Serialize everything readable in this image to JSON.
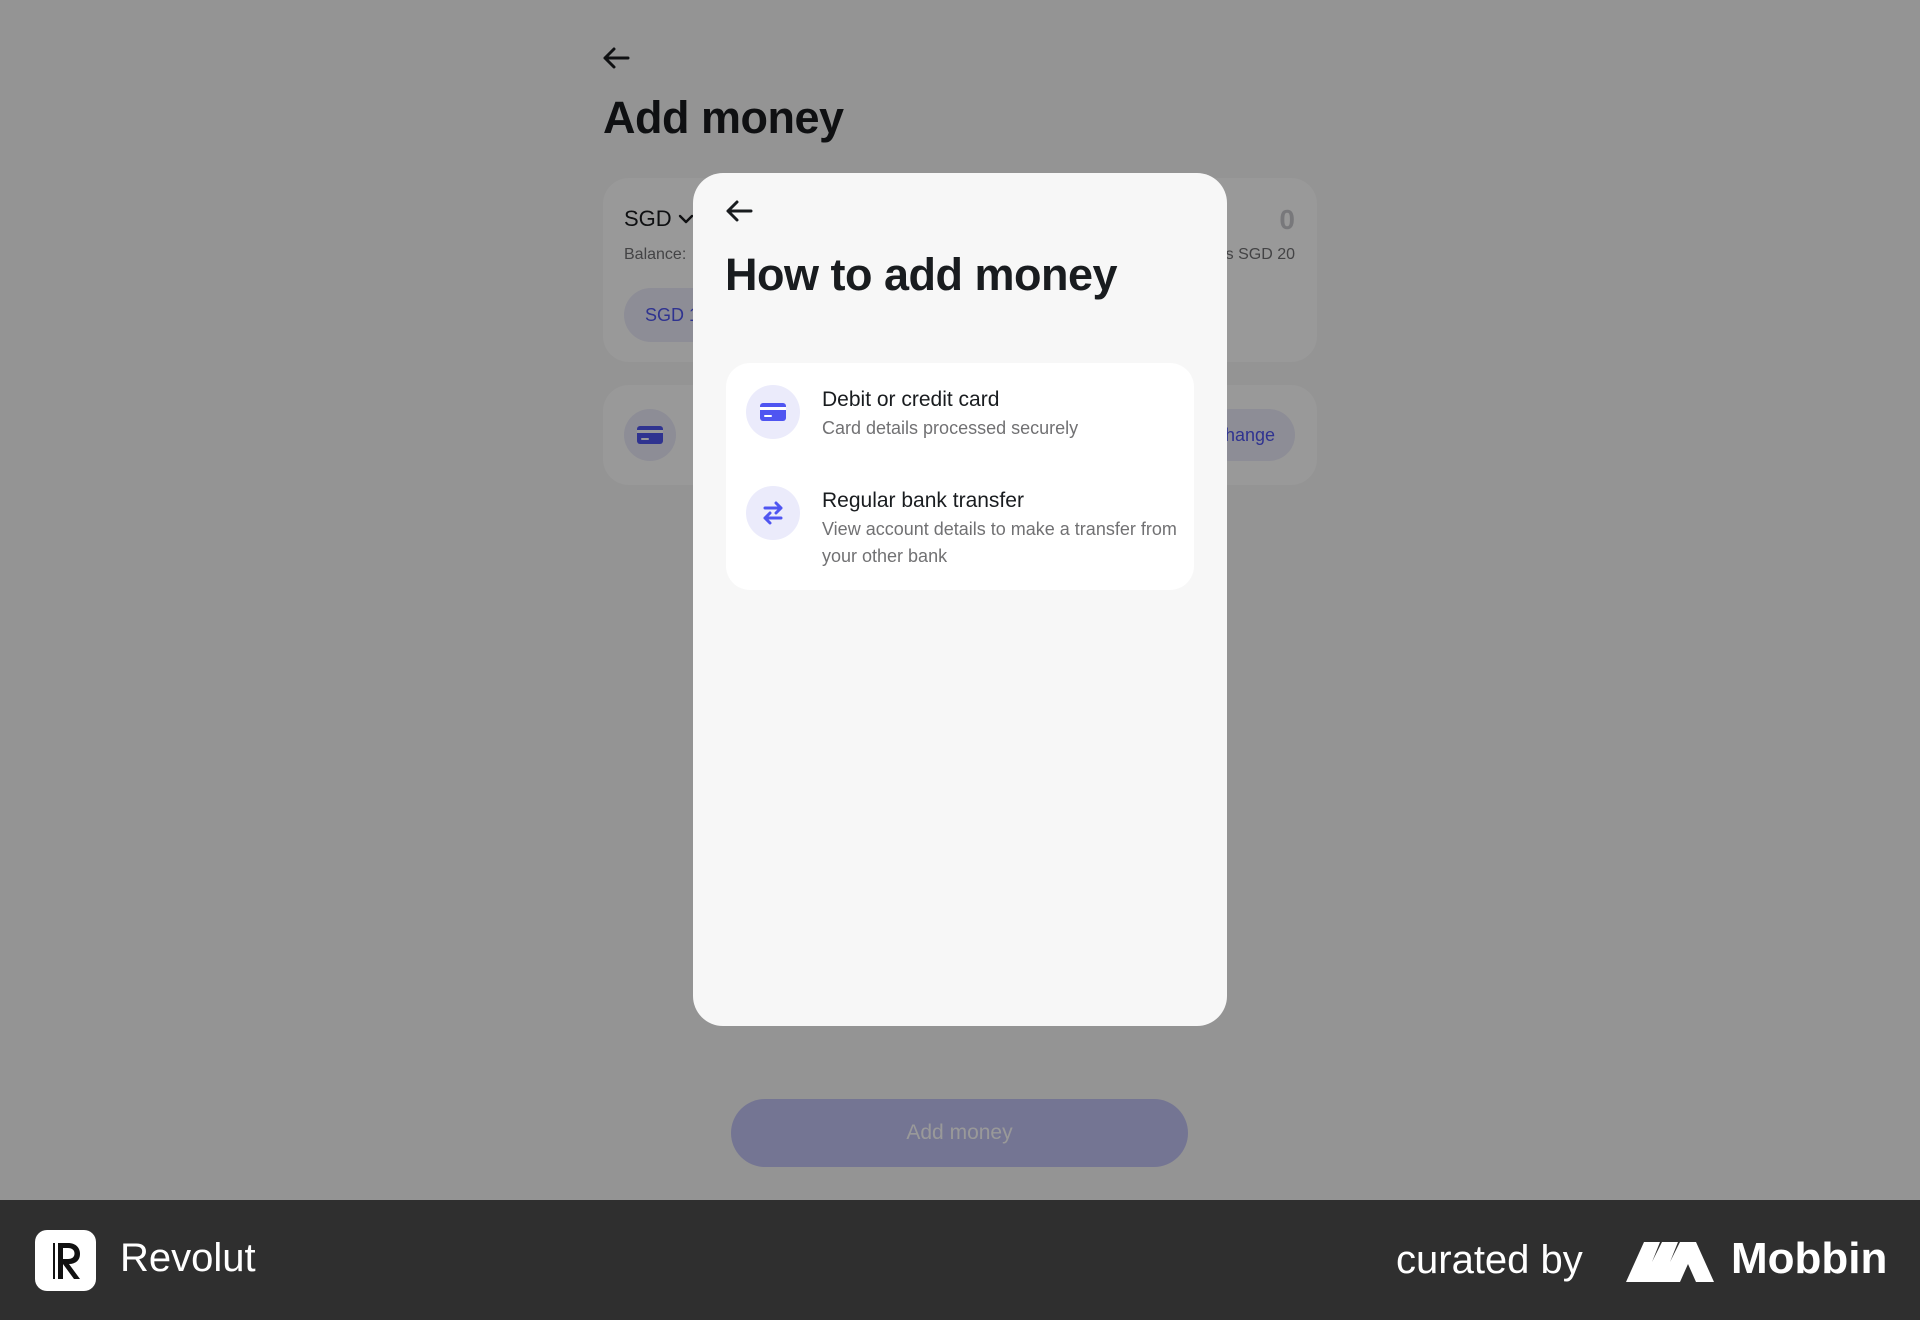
{
  "background_page": {
    "title": "Add money",
    "currency": "SGD",
    "balance_label": "Balance:",
    "quick_amount_chip": "SGD 1",
    "amount": "0",
    "amount_hint": "s SGD 20",
    "method_action": "hange",
    "submit_label": "Add money"
  },
  "modal": {
    "title": "How to add money",
    "options": [
      {
        "title": "Debit or credit card",
        "subtitle": "Card details processed securely",
        "icon": "credit-card-icon"
      },
      {
        "title": "Regular bank transfer",
        "subtitle": "View account details to make a transfer from your other bank",
        "icon": "transfer-arrows-icon"
      }
    ]
  },
  "footer": {
    "app_name": "Revolut",
    "curated_by": "curated by",
    "curator": "Mobbin"
  },
  "colors": {
    "accent": "#4f55f1",
    "accent_soft": "#ebebfb",
    "text_primary": "#191c1f",
    "text_secondary": "#717173",
    "footer_bg": "#2f2f2f"
  }
}
